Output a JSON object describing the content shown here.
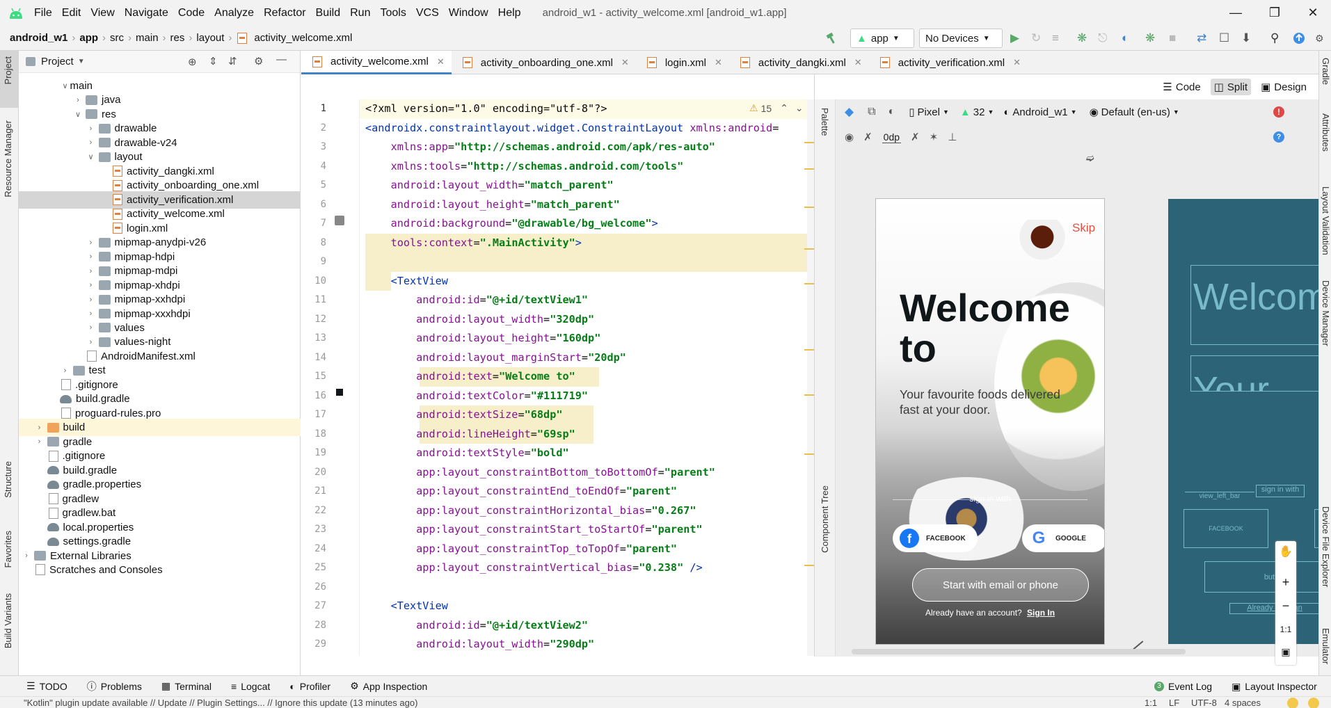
{
  "menubar": {
    "items": [
      "File",
      "Edit",
      "View",
      "Navigate",
      "Code",
      "Analyze",
      "Refactor",
      "Build",
      "Run",
      "Tools",
      "VCS",
      "Window",
      "Help"
    ],
    "title": "android_w1 - activity_welcome.xml [android_w1.app]"
  },
  "navbar": {
    "crumbs": [
      "android_w1",
      "app",
      "src",
      "main",
      "res",
      "layout",
      "activity_welcome.xml"
    ],
    "run_config": "app",
    "device": "No Devices"
  },
  "project": {
    "title": "Project",
    "tree": [
      {
        "label": "main",
        "indent": 3,
        "arrow": "down",
        "icon": "none"
      },
      {
        "label": "java",
        "indent": 4,
        "arrow": "right",
        "icon": "folder"
      },
      {
        "label": "res",
        "indent": 4,
        "arrow": "down",
        "icon": "folder"
      },
      {
        "label": "drawable",
        "indent": 5,
        "arrow": "right",
        "icon": "folder"
      },
      {
        "label": "drawable-v24",
        "indent": 5,
        "arrow": "right",
        "icon": "folder"
      },
      {
        "label": "layout",
        "indent": 5,
        "arrow": "down",
        "icon": "folder"
      },
      {
        "label": "activity_dangki.xml",
        "indent": 6,
        "arrow": "",
        "icon": "xml"
      },
      {
        "label": "activity_onboarding_one.xml",
        "indent": 6,
        "arrow": "",
        "icon": "xml"
      },
      {
        "label": "activity_verification.xml",
        "indent": 6,
        "arrow": "",
        "icon": "xml",
        "selected": true
      },
      {
        "label": "activity_welcome.xml",
        "indent": 6,
        "arrow": "",
        "icon": "xml"
      },
      {
        "label": "login.xml",
        "indent": 6,
        "arrow": "",
        "icon": "xml"
      },
      {
        "label": "mipmap-anydpi-v26",
        "indent": 5,
        "arrow": "right",
        "icon": "folder"
      },
      {
        "label": "mipmap-hdpi",
        "indent": 5,
        "arrow": "right",
        "icon": "folder"
      },
      {
        "label": "mipmap-mdpi",
        "indent": 5,
        "arrow": "right",
        "icon": "folder"
      },
      {
        "label": "mipmap-xhdpi",
        "indent": 5,
        "arrow": "right",
        "icon": "folder"
      },
      {
        "label": "mipmap-xxhdpi",
        "indent": 5,
        "arrow": "right",
        "icon": "folder"
      },
      {
        "label": "mipmap-xxxhdpi",
        "indent": 5,
        "arrow": "right",
        "icon": "folder"
      },
      {
        "label": "values",
        "indent": 5,
        "arrow": "right",
        "icon": "folder"
      },
      {
        "label": "values-night",
        "indent": 5,
        "arrow": "right",
        "icon": "folder"
      },
      {
        "label": "AndroidManifest.xml",
        "indent": 4,
        "arrow": "",
        "icon": "file"
      },
      {
        "label": "test",
        "indent": 3,
        "arrow": "right",
        "icon": "folder"
      },
      {
        "label": ".gitignore",
        "indent": 2,
        "arrow": "",
        "icon": "file"
      },
      {
        "label": "build.gradle",
        "indent": 2,
        "arrow": "",
        "icon": "gradle"
      },
      {
        "label": "proguard-rules.pro",
        "indent": 2,
        "arrow": "",
        "icon": "file"
      },
      {
        "label": "build",
        "indent": 1,
        "arrow": "right",
        "icon": "folder-orange",
        "highlight": true
      },
      {
        "label": "gradle",
        "indent": 1,
        "arrow": "right",
        "icon": "folder"
      },
      {
        "label": ".gitignore",
        "indent": 1,
        "arrow": "",
        "icon": "file"
      },
      {
        "label": "build.gradle",
        "indent": 1,
        "arrow": "",
        "icon": "gradle"
      },
      {
        "label": "gradle.properties",
        "indent": 1,
        "arrow": "",
        "icon": "gradle"
      },
      {
        "label": "gradlew",
        "indent": 1,
        "arrow": "",
        "icon": "file"
      },
      {
        "label": "gradlew.bat",
        "indent": 1,
        "arrow": "",
        "icon": "file"
      },
      {
        "label": "local.properties",
        "indent": 1,
        "arrow": "",
        "icon": "gradle"
      },
      {
        "label": "settings.gradle",
        "indent": 1,
        "arrow": "",
        "icon": "gradle"
      },
      {
        "label": "External Libraries",
        "indent": 0,
        "arrow": "right",
        "icon": "folder"
      },
      {
        "label": "Scratches and Consoles",
        "indent": 0,
        "arrow": "",
        "icon": "file"
      }
    ]
  },
  "left_strip": [
    "Project",
    "Resource Manager",
    "Structure",
    "Favorites",
    "Build Variants"
  ],
  "tabs": [
    "activity_welcome.xml",
    "activity_onboarding_one.xml",
    "login.xml",
    "activity_dangki.xml",
    "activity_verification.xml"
  ],
  "editor": {
    "view_modes": [
      "Code",
      "Split",
      "Design"
    ],
    "warnings": "15",
    "lines": [
      [
        [
          "c",
          "<?xml version=\"1.0\" encoding=\"utf-8\"?>"
        ]
      ],
      [
        [
          "t",
          "<androidx.constraintlayout.widget.ConstraintLayout "
        ],
        [
          "k",
          "xmlns:android"
        ],
        [
          "c",
          "="
        ]
      ],
      [
        [
          "c",
          "    "
        ],
        [
          "k",
          "xmlns:app"
        ],
        [
          "c",
          "="
        ],
        [
          "s",
          "\"http://schemas.android.com/apk/res-auto\""
        ]
      ],
      [
        [
          "c",
          "    "
        ],
        [
          "k",
          "xmlns:tools"
        ],
        [
          "c",
          "="
        ],
        [
          "s",
          "\"http://schemas.android.com/tools\""
        ]
      ],
      [
        [
          "c",
          "    "
        ],
        [
          "k",
          "android:layout_width"
        ],
        [
          "c",
          "="
        ],
        [
          "s",
          "\"match_parent\""
        ]
      ],
      [
        [
          "c",
          "    "
        ],
        [
          "k",
          "android:layout_height"
        ],
        [
          "c",
          "="
        ],
        [
          "s",
          "\"match_parent\""
        ]
      ],
      [
        [
          "c",
          "    "
        ],
        [
          "k",
          "android:background"
        ],
        [
          "c",
          "="
        ],
        [
          "s",
          "\"@drawable/bg_welcome\""
        ],
        [
          "t",
          ">"
        ]
      ],
      [
        [
          "c",
          "    "
        ],
        [
          "k",
          "tools:context"
        ],
        [
          "c",
          "="
        ],
        [
          "s",
          "\".MainActivity\""
        ],
        [
          "t",
          ">"
        ]
      ],
      [
        [
          "c",
          ""
        ]
      ],
      [
        [
          "c",
          "    "
        ],
        [
          "t",
          "<TextView"
        ]
      ],
      [
        [
          "c",
          "        "
        ],
        [
          "k",
          "android:id"
        ],
        [
          "c",
          "="
        ],
        [
          "s",
          "\"@+id/textView1\""
        ]
      ],
      [
        [
          "c",
          "        "
        ],
        [
          "k",
          "android:layout_width"
        ],
        [
          "c",
          "="
        ],
        [
          "s",
          "\"320dp\""
        ]
      ],
      [
        [
          "c",
          "        "
        ],
        [
          "k",
          "android:layout_height"
        ],
        [
          "c",
          "="
        ],
        [
          "s",
          "\"160dp\""
        ]
      ],
      [
        [
          "c",
          "        "
        ],
        [
          "k",
          "android:layout_marginStart"
        ],
        [
          "c",
          "="
        ],
        [
          "s",
          "\"20dp\""
        ]
      ],
      [
        [
          "c",
          "        "
        ],
        [
          "k",
          "android:text"
        ],
        [
          "c",
          "="
        ],
        [
          "s",
          "\"Welcome to\""
        ]
      ],
      [
        [
          "c",
          "        "
        ],
        [
          "k",
          "android:textColor"
        ],
        [
          "c",
          "="
        ],
        [
          "s",
          "\"#111719\""
        ]
      ],
      [
        [
          "c",
          "        "
        ],
        [
          "k",
          "android:textSize"
        ],
        [
          "c",
          "="
        ],
        [
          "s",
          "\"68dp\""
        ]
      ],
      [
        [
          "c",
          "        "
        ],
        [
          "k",
          "android:lineHeight"
        ],
        [
          "c",
          "="
        ],
        [
          "s",
          "\"69sp\""
        ]
      ],
      [
        [
          "c",
          "        "
        ],
        [
          "k",
          "android:textStyle"
        ],
        [
          "c",
          "="
        ],
        [
          "s",
          "\"bold\""
        ]
      ],
      [
        [
          "c",
          "        "
        ],
        [
          "k",
          "app:layout_constraintBottom_toBottomOf"
        ],
        [
          "c",
          "="
        ],
        [
          "s",
          "\"parent\""
        ]
      ],
      [
        [
          "c",
          "        "
        ],
        [
          "k",
          "app:layout_constraintEnd_toEndOf"
        ],
        [
          "c",
          "="
        ],
        [
          "s",
          "\"parent\""
        ]
      ],
      [
        [
          "c",
          "        "
        ],
        [
          "k",
          "app:layout_constraintHorizontal_bias"
        ],
        [
          "c",
          "="
        ],
        [
          "s",
          "\"0.267\""
        ]
      ],
      [
        [
          "c",
          "        "
        ],
        [
          "k",
          "app:layout_constraintStart_toStartOf"
        ],
        [
          "c",
          "="
        ],
        [
          "s",
          "\"parent\""
        ]
      ],
      [
        [
          "c",
          "        "
        ],
        [
          "k",
          "app:layout_constraintTop_toTopOf"
        ],
        [
          "c",
          "="
        ],
        [
          "s",
          "\"parent\""
        ]
      ],
      [
        [
          "c",
          "        "
        ],
        [
          "k",
          "app:layout_constraintVertical_bias"
        ],
        [
          "c",
          "="
        ],
        [
          "s",
          "\"0.238\""
        ],
        [
          "t",
          " />"
        ]
      ],
      [
        [
          "c",
          ""
        ]
      ],
      [
        [
          "c",
          "    "
        ],
        [
          "t",
          "<TextView"
        ]
      ],
      [
        [
          "c",
          "        "
        ],
        [
          "k",
          "android:id"
        ],
        [
          "c",
          "="
        ],
        [
          "s",
          "\"@+id/textView2\""
        ]
      ],
      [
        [
          "c",
          "        "
        ],
        [
          "k",
          "android:layout_width"
        ],
        [
          "c",
          "="
        ],
        [
          "s",
          "\"290dp\""
        ]
      ]
    ]
  },
  "preview": {
    "device": "Pixel",
    "api": "32",
    "theme": "Android_w1",
    "locale": "Default (en-us)",
    "margin": "0dp",
    "phone": {
      "skip": "Skip",
      "welcome": "Welcome to",
      "subtitle": "Your favourite foods delivered fast at your door.",
      "sign_in_with": "sign in with",
      "facebook": "FACEBOOK",
      "google": "GOOGLE",
      "start_button": "Start with email or phone",
      "have_account": "Already have an account?",
      "sign_in": "Sign In"
    },
    "blueprint": {
      "welcome": "Welcom",
      "your": "Your",
      "view_left_bar": "view_left_bar",
      "sign_in_with": "sign in with",
      "facebook": "FACEBOOK",
      "button_start": "butt",
      "already": "Already have an"
    },
    "zoom": "1:1",
    "palette": "Palette",
    "component_tree": "Component Tree"
  },
  "right_strip": [
    "Gradle",
    "Attributes",
    "Layout Validation",
    "Device Manager",
    "Device File Explorer",
    "Emulator"
  ],
  "bottom_tools": [
    "TODO",
    "Problems",
    "Terminal",
    "Logcat",
    "Profiler",
    "App Inspection"
  ],
  "bottom_right_tools": [
    "Event Log",
    "Layout Inspector"
  ],
  "statusbar": {
    "message": "\"Kotlin\" plugin update available // Update // Plugin Settings... // Ignore this update (13 minutes ago)",
    "position": "1:1",
    "line_sep": "LF",
    "encoding": "UTF-8",
    "indent": "4 spaces"
  }
}
